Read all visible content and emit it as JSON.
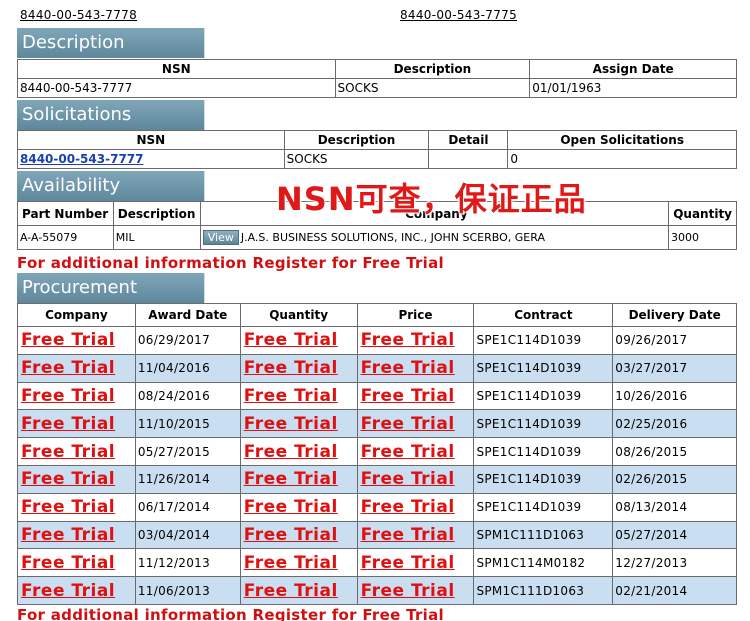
{
  "top_links": [
    "8440-00-543-7778",
    "8440-00-543-7775"
  ],
  "sections": {
    "description": "Description",
    "solicitations": "Solicitations",
    "availability": "Availability",
    "procurement": "Procurement"
  },
  "description_table": {
    "headers": [
      "NSN",
      "Description",
      "Assign Date"
    ],
    "row": [
      "8440-00-543-7777",
      "SOCKS",
      "01/01/1963"
    ]
  },
  "solicitations_table": {
    "headers": [
      "NSN",
      "Description",
      "Detail",
      "Open Solicitations"
    ],
    "row": [
      "8440-00-543-7777",
      "SOCKS",
      "",
      "0"
    ]
  },
  "availability_table": {
    "headers": [
      "Part Number",
      "Description",
      "Company",
      "Quantity"
    ],
    "row": {
      "part_number": "A-A-55079",
      "description": "MIL",
      "view_label": "View",
      "company": "J.A.S. BUSINESS SOLUTIONS, INC., JOHN SCERBO, GERA",
      "quantity": "3000"
    }
  },
  "register_link": "For additional information Register for Free Trial",
  "watermark": "NSN可查，保证正品",
  "procurement_table": {
    "headers": [
      "Company",
      "Award Date",
      "Quantity",
      "Price",
      "Contract",
      "Delivery Date"
    ],
    "free_trial": "Free Trial",
    "rows": [
      {
        "award_date": "06/29/2017",
        "contract": "SPE1C114D1039",
        "delivery_date": "09/26/2017"
      },
      {
        "award_date": "11/04/2016",
        "contract": "SPE1C114D1039",
        "delivery_date": "03/27/2017"
      },
      {
        "award_date": "08/24/2016",
        "contract": "SPE1C114D1039",
        "delivery_date": "10/26/2016"
      },
      {
        "award_date": "11/10/2015",
        "contract": "SPE1C114D1039",
        "delivery_date": "02/25/2016"
      },
      {
        "award_date": "05/27/2015",
        "contract": "SPE1C114D1039",
        "delivery_date": "08/26/2015"
      },
      {
        "award_date": "11/26/2014",
        "contract": "SPE1C114D1039",
        "delivery_date": "02/26/2015"
      },
      {
        "award_date": "06/17/2014",
        "contract": "SPE1C114D1039",
        "delivery_date": "08/13/2014"
      },
      {
        "award_date": "03/04/2014",
        "contract": "SPM1C111D1063",
        "delivery_date": "05/27/2014"
      },
      {
        "award_date": "11/12/2013",
        "contract": "SPM1C114M0182",
        "delivery_date": "12/27/2013"
      },
      {
        "award_date": "11/06/2013",
        "contract": "SPM1C111D1063",
        "delivery_date": "02/21/2014"
      }
    ]
  },
  "colors": {
    "header_bg": "#6f97aa",
    "alt_row": "#c9def0",
    "link_red": "#e01010",
    "nsn_link": "#1a3fb0"
  }
}
